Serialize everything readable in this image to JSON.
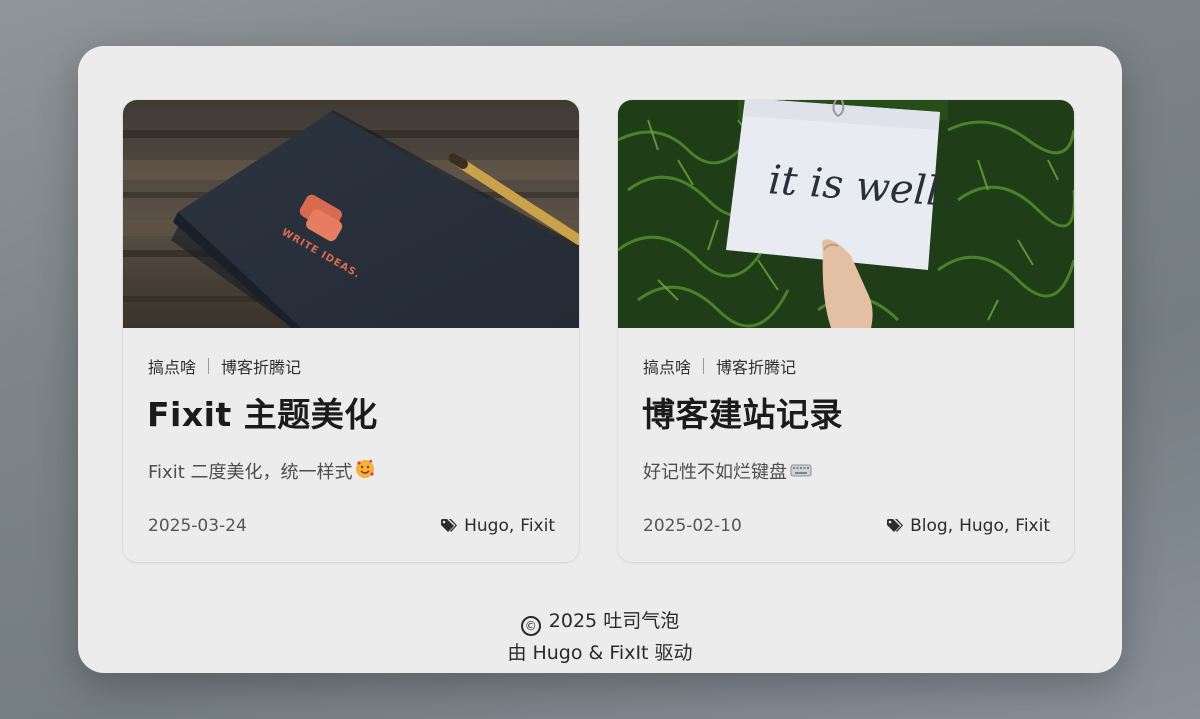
{
  "posts": [
    {
      "image": "notebook-write-ideas-photo",
      "image_text": "WRITE IDEAS.",
      "category_1": "搞点啥",
      "category_2": "博客折腾记",
      "title": "Fixit 主题美化",
      "summary": "Fixit 二度美化，统一样式",
      "summary_emoji": "face-hearts-icon",
      "date": "2025-03-24",
      "tags": [
        "Hugo",
        "Fixit"
      ]
    },
    {
      "image": "it-is-well-sign-photo",
      "image_text": "it is well.",
      "category_1": "搞点啥",
      "category_2": "博客折腾记",
      "title": "博客建站记录",
      "summary": "好记性不如烂键盘",
      "summary_emoji": "keyboard-icon",
      "date": "2025-02-10",
      "tags": [
        "Blog",
        "Hugo",
        "Fixit"
      ]
    }
  ],
  "footer": {
    "copyright_symbol": "©",
    "copyright": "2025 吐司气泡",
    "powered_by": "由 Hugo & FixIt 驱动"
  },
  "colors": {
    "panel": "#ececec",
    "title": "#1b1b1b",
    "muted": "#565656"
  }
}
